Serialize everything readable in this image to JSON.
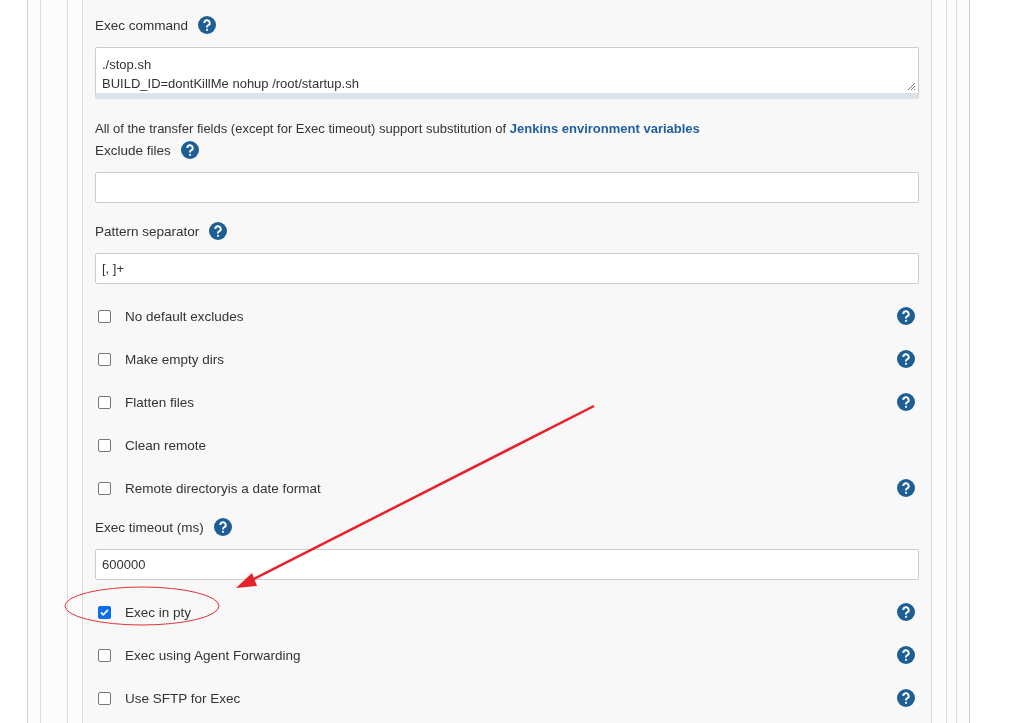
{
  "items": [
    {
      "kind": "textarea",
      "label": "Exec command",
      "help": true,
      "lines": [
        "./stop.sh",
        "BUILD_ID=dontKillMe nohup /root/startup.sh"
      ]
    },
    {
      "kind": "note",
      "text": "All of the transfer fields (except for Exec timeout) support substitution of",
      "link": "Jenkins environment variables"
    },
    {
      "kind": "field",
      "label": "Exclude files",
      "help": true,
      "value": ""
    },
    {
      "kind": "field",
      "label": "Pattern separator",
      "help": true,
      "value": "[, ]+"
    },
    {
      "kind": "checkbox",
      "label": "No default excludes",
      "checked": false,
      "help": true
    },
    {
      "kind": "checkbox",
      "label": "Make empty dirs",
      "checked": false,
      "help": true
    },
    {
      "kind": "checkbox",
      "label": "Flatten files",
      "checked": false,
      "help": true
    },
    {
      "kind": "checkbox",
      "label": "Clean remote",
      "checked": false,
      "help": false
    },
    {
      "kind": "checkbox",
      "label": "Remote directoryis a date format",
      "checked": false,
      "help": true
    },
    {
      "kind": "field",
      "label": "Exec timeout (ms)",
      "help": true,
      "value": "600000"
    },
    {
      "kind": "checkbox",
      "label": "Exec in pty",
      "checked": true,
      "help": true
    },
    {
      "kind": "checkbox",
      "label": "Exec using Agent Forwarding",
      "checked": false,
      "help": true
    },
    {
      "kind": "checkbox",
      "label": "Use SFTP for Exec",
      "checked": false,
      "help": true
    }
  ]
}
